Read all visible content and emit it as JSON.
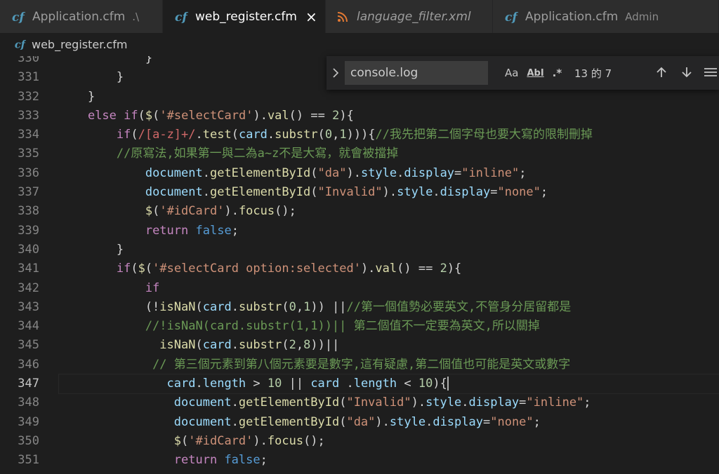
{
  "tabs": [
    {
      "label": "Application.cfm",
      "desc": ".\\"
    },
    {
      "label": "web_register.cfm",
      "close": "×"
    },
    {
      "label": "language_filter.xml"
    },
    {
      "label": "Application.cfm",
      "desc": "Admin"
    }
  ],
  "breadcrumb": {
    "file": "web_register.cfm"
  },
  "find": {
    "query": "console.log",
    "match_case": "Aa",
    "whole_word": "AbI",
    "regex": ".*",
    "count": "13 的 7"
  },
  "editor": {
    "current_line": "347",
    "line_numbers": [
      "330",
      "331",
      "332",
      "333",
      "334",
      "335",
      "336",
      "337",
      "338",
      "339",
      "340",
      "341",
      "342",
      "343",
      "344",
      "345",
      "346",
      "347",
      "348",
      "349",
      "350",
      "351"
    ],
    "lines": [
      [
        {
          "t": "            }",
          "c": "pl"
        }
      ],
      [
        {
          "t": "        }",
          "c": "pl"
        }
      ],
      [
        {
          "t": "    }",
          "c": "pl"
        }
      ],
      [
        {
          "t": "    ",
          "c": "pl"
        },
        {
          "t": "else",
          "c": "kw"
        },
        {
          "t": " ",
          "c": "pl"
        },
        {
          "t": "if",
          "c": "kw"
        },
        {
          "t": "(",
          "c": "pl"
        },
        {
          "t": "$",
          "c": "fn"
        },
        {
          "t": "(",
          "c": "pl"
        },
        {
          "t": "'#selectCard'",
          "c": "str"
        },
        {
          "t": ").",
          "c": "pl"
        },
        {
          "t": "val",
          "c": "fn"
        },
        {
          "t": "() == ",
          "c": "pl"
        },
        {
          "t": "2",
          "c": "num"
        },
        {
          "t": "){",
          "c": "pl"
        }
      ],
      [
        {
          "t": "        ",
          "c": "pl"
        },
        {
          "t": "if",
          "c": "kw"
        },
        {
          "t": "(",
          "c": "pl"
        },
        {
          "t": "/[a-z]+/",
          "c": "rx"
        },
        {
          "t": ".",
          "c": "pl"
        },
        {
          "t": "test",
          "c": "fn"
        },
        {
          "t": "(",
          "c": "pl"
        },
        {
          "t": "card",
          "c": "var"
        },
        {
          "t": ".",
          "c": "pl"
        },
        {
          "t": "substr",
          "c": "fn"
        },
        {
          "t": "(",
          "c": "pl"
        },
        {
          "t": "0",
          "c": "num"
        },
        {
          "t": ",",
          "c": "pl"
        },
        {
          "t": "1",
          "c": "num"
        },
        {
          "t": "))){",
          "c": "pl"
        },
        {
          "t": "//我先把第二個字母也要大寫的限制刪掉",
          "c": "cm"
        }
      ],
      [
        {
          "t": "        ",
          "c": "pl"
        },
        {
          "t": "//原寫法,如果第一與二為a~z不是大寫，就會被擋掉",
          "c": "cm"
        }
      ],
      [
        {
          "t": "            ",
          "c": "pl"
        },
        {
          "t": "document",
          "c": "var"
        },
        {
          "t": ".",
          "c": "pl"
        },
        {
          "t": "getElementById",
          "c": "fn"
        },
        {
          "t": "(",
          "c": "pl"
        },
        {
          "t": "\"da\"",
          "c": "str"
        },
        {
          "t": ").",
          "c": "pl"
        },
        {
          "t": "style",
          "c": "var"
        },
        {
          "t": ".",
          "c": "pl"
        },
        {
          "t": "display",
          "c": "var"
        },
        {
          "t": "=",
          "c": "pl"
        },
        {
          "t": "\"inline\"",
          "c": "str"
        },
        {
          "t": ";",
          "c": "pl"
        }
      ],
      [
        {
          "t": "            ",
          "c": "pl"
        },
        {
          "t": "document",
          "c": "var"
        },
        {
          "t": ".",
          "c": "pl"
        },
        {
          "t": "getElementById",
          "c": "fn"
        },
        {
          "t": "(",
          "c": "pl"
        },
        {
          "t": "\"Invalid\"",
          "c": "str"
        },
        {
          "t": ").",
          "c": "pl"
        },
        {
          "t": "style",
          "c": "var"
        },
        {
          "t": ".",
          "c": "pl"
        },
        {
          "t": "display",
          "c": "var"
        },
        {
          "t": "=",
          "c": "pl"
        },
        {
          "t": "\"none\"",
          "c": "str"
        },
        {
          "t": ";",
          "c": "pl"
        }
      ],
      [
        {
          "t": "            ",
          "c": "pl"
        },
        {
          "t": "$",
          "c": "fn"
        },
        {
          "t": "(",
          "c": "pl"
        },
        {
          "t": "'#idCard'",
          "c": "str"
        },
        {
          "t": ").",
          "c": "pl"
        },
        {
          "t": "focus",
          "c": "fn"
        },
        {
          "t": "();",
          "c": "pl"
        }
      ],
      [
        {
          "t": "            ",
          "c": "pl"
        },
        {
          "t": "return",
          "c": "kw"
        },
        {
          "t": " ",
          "c": "pl"
        },
        {
          "t": "false",
          "c": "kb"
        },
        {
          "t": ";",
          "c": "pl"
        }
      ],
      [
        {
          "t": "        }",
          "c": "pl"
        }
      ],
      [
        {
          "t": "        ",
          "c": "pl"
        },
        {
          "t": "if",
          "c": "kw"
        },
        {
          "t": "(",
          "c": "pl"
        },
        {
          "t": "$",
          "c": "fn"
        },
        {
          "t": "(",
          "c": "pl"
        },
        {
          "t": "'#selectCard option:selected'",
          "c": "str"
        },
        {
          "t": ").",
          "c": "pl"
        },
        {
          "t": "val",
          "c": "fn"
        },
        {
          "t": "() == ",
          "c": "pl"
        },
        {
          "t": "2",
          "c": "num"
        },
        {
          "t": "){",
          "c": "pl"
        }
      ],
      [
        {
          "t": "            ",
          "c": "pl"
        },
        {
          "t": "if",
          "c": "kw"
        }
      ],
      [
        {
          "t": "            (!",
          "c": "pl"
        },
        {
          "t": "isNaN",
          "c": "fn"
        },
        {
          "t": "(",
          "c": "pl"
        },
        {
          "t": "card",
          "c": "var"
        },
        {
          "t": ".",
          "c": "pl"
        },
        {
          "t": "substr",
          "c": "fn"
        },
        {
          "t": "(",
          "c": "pl"
        },
        {
          "t": "0",
          "c": "num"
        },
        {
          "t": ",",
          "c": "pl"
        },
        {
          "t": "1",
          "c": "num"
        },
        {
          "t": ")) ||",
          "c": "pl"
        },
        {
          "t": "//第一個值勢必要英文,不管身分居留都是",
          "c": "cm"
        }
      ],
      [
        {
          "t": "            ",
          "c": "pl"
        },
        {
          "t": "//!isNaN(card.substr(1,1))|| 第二個值不一定要為英文,所以關掉",
          "c": "cm"
        }
      ],
      [
        {
          "t": "              ",
          "c": "pl"
        },
        {
          "t": "isNaN",
          "c": "fn"
        },
        {
          "t": "(",
          "c": "pl"
        },
        {
          "t": "card",
          "c": "var"
        },
        {
          "t": ".",
          "c": "pl"
        },
        {
          "t": "substr",
          "c": "fn"
        },
        {
          "t": "(",
          "c": "pl"
        },
        {
          "t": "2",
          "c": "num"
        },
        {
          "t": ",",
          "c": "pl"
        },
        {
          "t": "8",
          "c": "num"
        },
        {
          "t": "))||",
          "c": "pl"
        }
      ],
      [
        {
          "t": "             ",
          "c": "pl"
        },
        {
          "t": "// 第三個元素到第八個元素要是數字,這有疑慮,第二個值也可能是英文或數字",
          "c": "cm"
        }
      ],
      [
        {
          "t": "               ",
          "c": "pl"
        },
        {
          "t": "card",
          "c": "var"
        },
        {
          "t": ".",
          "c": "pl"
        },
        {
          "t": "length",
          "c": "var"
        },
        {
          "t": " > ",
          "c": "pl"
        },
        {
          "t": "10",
          "c": "num"
        },
        {
          "t": " || ",
          "c": "pl"
        },
        {
          "t": "card",
          "c": "var"
        },
        {
          "t": " .",
          "c": "pl"
        },
        {
          "t": "length",
          "c": "var"
        },
        {
          "t": " < ",
          "c": "pl"
        },
        {
          "t": "10",
          "c": "num"
        },
        {
          "t": "){",
          "c": "pl"
        }
      ],
      [
        {
          "t": "                ",
          "c": "pl"
        },
        {
          "t": "document",
          "c": "var"
        },
        {
          "t": ".",
          "c": "pl"
        },
        {
          "t": "getElementById",
          "c": "fn"
        },
        {
          "t": "(",
          "c": "pl"
        },
        {
          "t": "\"Invalid\"",
          "c": "str"
        },
        {
          "t": ").",
          "c": "pl"
        },
        {
          "t": "style",
          "c": "var"
        },
        {
          "t": ".",
          "c": "pl"
        },
        {
          "t": "display",
          "c": "var"
        },
        {
          "t": "=",
          "c": "pl"
        },
        {
          "t": "\"inline\"",
          "c": "str"
        },
        {
          "t": ";",
          "c": "pl"
        }
      ],
      [
        {
          "t": "                ",
          "c": "pl"
        },
        {
          "t": "document",
          "c": "var"
        },
        {
          "t": ".",
          "c": "pl"
        },
        {
          "t": "getElementById",
          "c": "fn"
        },
        {
          "t": "(",
          "c": "pl"
        },
        {
          "t": "\"da\"",
          "c": "str"
        },
        {
          "t": ").",
          "c": "pl"
        },
        {
          "t": "style",
          "c": "var"
        },
        {
          "t": ".",
          "c": "pl"
        },
        {
          "t": "display",
          "c": "var"
        },
        {
          "t": "=",
          "c": "pl"
        },
        {
          "t": "\"none\"",
          "c": "str"
        },
        {
          "t": ";",
          "c": "pl"
        }
      ],
      [
        {
          "t": "                ",
          "c": "pl"
        },
        {
          "t": "$",
          "c": "fn"
        },
        {
          "t": "(",
          "c": "pl"
        },
        {
          "t": "'#idCard'",
          "c": "str"
        },
        {
          "t": ").",
          "c": "pl"
        },
        {
          "t": "focus",
          "c": "fn"
        },
        {
          "t": "();",
          "c": "pl"
        }
      ],
      [
        {
          "t": "                ",
          "c": "pl"
        },
        {
          "t": "return",
          "c": "kw"
        },
        {
          "t": " ",
          "c": "pl"
        },
        {
          "t": "false",
          "c": "kb"
        },
        {
          "t": ";",
          "c": "pl"
        }
      ]
    ]
  }
}
